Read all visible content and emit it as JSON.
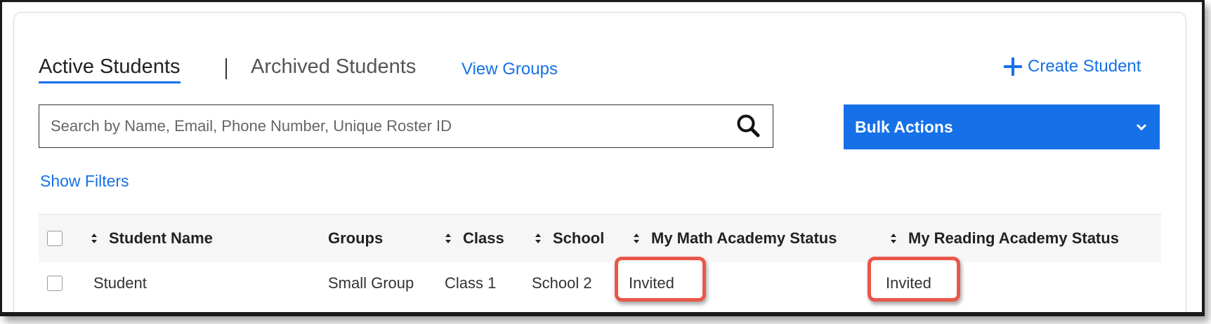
{
  "tabs": {
    "active_label": "Active Students",
    "separator": "|",
    "archived_label": "Archived Students",
    "view_groups_label": "View Groups"
  },
  "actions": {
    "create_student_label": "Create Student",
    "bulk_actions_label": "Bulk Actions",
    "show_filters_label": "Show Filters"
  },
  "search": {
    "placeholder": "Search by Name, Email, Phone Number, Unique Roster ID",
    "value": ""
  },
  "table": {
    "columns": [
      {
        "label": "Student Name",
        "sortable": true
      },
      {
        "label": "Groups",
        "sortable": false
      },
      {
        "label": "Class",
        "sortable": true
      },
      {
        "label": "School",
        "sortable": true
      },
      {
        "label": "My Math Academy Status",
        "sortable": true
      },
      {
        "label": "My Reading Academy Status",
        "sortable": true
      }
    ],
    "rows": [
      {
        "student_name": "Student",
        "groups": "Small Group",
        "class": "Class 1",
        "school": "School 2",
        "math_status": "Invited",
        "reading_status": "Invited"
      }
    ]
  },
  "colors": {
    "accent": "#1670e8",
    "highlight": "#e8574a"
  },
  "icons": [
    "plus-icon",
    "search-icon",
    "chevron-down-icon",
    "sort-icon"
  ]
}
